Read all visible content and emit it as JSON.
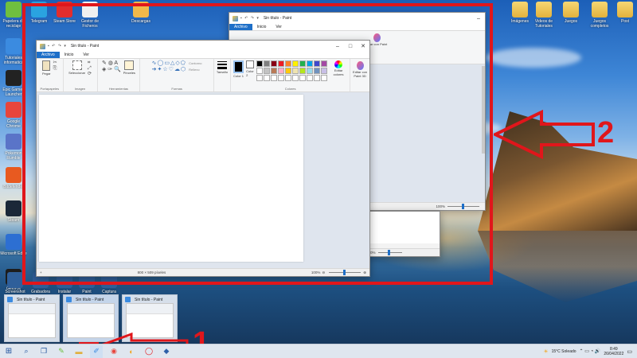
{
  "desktop": {
    "icons_left": [
      {
        "label": "Papelera de reciclaje",
        "color": "#6fbf3f"
      },
      {
        "label": "Tutoriales informatica",
        "color": "#3b8be0"
      },
      {
        "label": "Epic Games Launcher",
        "color": "#222222"
      },
      {
        "label": "Google Chrome",
        "color": "#e8453c"
      },
      {
        "label": "Pokemon Rumble",
        "color": "#5a74c8"
      },
      {
        "label": "Bitdefender",
        "color": "#e85a20"
      },
      {
        "label": "Steam",
        "color": "#1b2838"
      },
      {
        "label": "Microsoft Edge",
        "color": "#2d6fd2"
      },
      {
        "label": "Geforce",
        "color": "#1d1d1d"
      }
    ],
    "icons_top": [
      {
        "label": "Telegram",
        "color": "#2aa3e0"
      },
      {
        "label": "Steam Store",
        "color": "#e22d2d"
      },
      {
        "label": "Gestor de Ficheros",
        "color": "#f0f0f0"
      },
      {
        "label": "Descargas",
        "color": "#f0b84a"
      }
    ],
    "icons_right": [
      {
        "label": "Imágenes"
      },
      {
        "label": "Videos de Tutoriales"
      },
      {
        "label": "Juegos"
      },
      {
        "label": "Juegos completos"
      },
      {
        "label": "Post"
      }
    ],
    "icons_bottom": [
      "Screenshot",
      "Grabadora",
      "Instalar",
      "Paint",
      "Captura"
    ]
  },
  "windows": {
    "back": {
      "title": "Sin título - Paint",
      "tabs": [
        "Archivo",
        "Inicio",
        "Ver"
      ],
      "zoom": "100%",
      "edit_label": "Editar con Paint 3D"
    },
    "front": {
      "title": "Sin título - Paint",
      "tabs": [
        "Archivo",
        "Inicio",
        "Ver"
      ],
      "groups": {
        "clipboard": "Portapapeles",
        "image": "Imagen",
        "tools": "Herramientas",
        "shapes": "Formas",
        "colors": "Colores"
      },
      "buttons": {
        "paste": "Pegar",
        "select": "Seleccionar",
        "brushes": "Pinceles",
        "outline": "Contorno",
        "fill": "Relleno",
        "size": "Tamaño",
        "color1": "Color 1",
        "color2": "Color 2",
        "edit_colors": "Editar colores",
        "edit_paint3d": "Editar con Paint 3D"
      },
      "status": {
        "dimensions": "800 × 509 píxeles",
        "zoom": "100%"
      }
    },
    "third": {
      "zoom": "100%"
    }
  },
  "palette": [
    "#000000",
    "#7f7f7f",
    "#880015",
    "#ed1c24",
    "#ff7f27",
    "#fff200",
    "#22b14c",
    "#00a2e8",
    "#3f48cc",
    "#a349a4",
    "#ffffff",
    "#c3c3c3",
    "#b97a57",
    "#ffaec9",
    "#ffc90e",
    "#efe4b0",
    "#b5e61d",
    "#99d9ea",
    "#7092be",
    "#c8bfe7",
    "#ffffff",
    "#ffffff",
    "#ffffff",
    "#ffffff",
    "#ffffff",
    "#ffffff",
    "#ffffff",
    "#ffffff",
    "#ffffff",
    "#ffffff"
  ],
  "thumbnails": [
    {
      "title": "Sin título - Paint"
    },
    {
      "title": "Sin título - Paint"
    },
    {
      "title": "Sin título - Paint"
    }
  ],
  "annotations": {
    "one": "1",
    "two": "2"
  },
  "taskbar": {
    "weather": "15°C  Soleado",
    "time": "8:49",
    "date": "26/04/2022"
  }
}
